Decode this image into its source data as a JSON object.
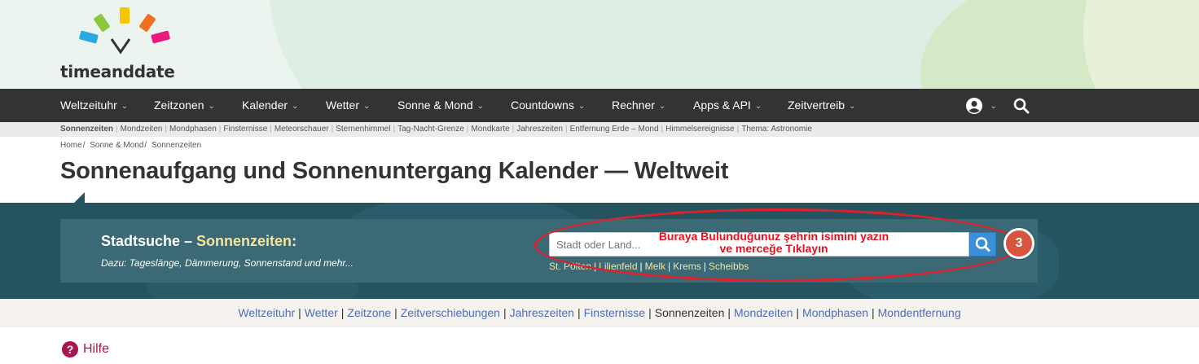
{
  "brand": {
    "logo_text": "timeanddate",
    "logo_colors": [
      "#8cc63f",
      "#f7c600",
      "#f26f22",
      "#ea1a7f",
      "#27aae1"
    ]
  },
  "nav": {
    "items": [
      {
        "label": "Weltzeituhr"
      },
      {
        "label": "Zeitzonen"
      },
      {
        "label": "Kalender"
      },
      {
        "label": "Wetter"
      },
      {
        "label": "Sonne & Mond"
      },
      {
        "label": "Countdowns"
      },
      {
        "label": "Rechner"
      },
      {
        "label": "Apps & API"
      },
      {
        "label": "Zeitvertreib"
      }
    ],
    "account_icon": "user-circle-icon",
    "search_icon": "search-icon"
  },
  "subnav": {
    "items": [
      "Sonnenzeiten",
      "Mondzeiten",
      "Mondphasen",
      "Finsternisse",
      "Meteorschauer",
      "Sternenhimmel",
      "Tag-Nacht-Grenze",
      "Mondkarte",
      "Jahreszeiten",
      "Entfernung Erde – Mond",
      "Himmelsereignisse",
      "Thema: Astronomie"
    ]
  },
  "breadcrumb": {
    "items": [
      "Home",
      "Sonne & Mond",
      "Sonnenzeiten"
    ]
  },
  "page_title": "Sonnenaufgang und Sonnenuntergang Kalender — Weltweit",
  "search": {
    "title_prefix": "Stadtsuche – ",
    "title_highlight": "Sonnenzeiten",
    "title_suffix": ":",
    "subtitle": "Dazu: Tageslänge, Dämmerung, Sonnenstand und mehr...",
    "placeholder": "Stadt oder Land...",
    "quick_links": [
      "St. Pölten",
      "Lilienfeld",
      "Melk",
      "Krems",
      "Scheibbs"
    ]
  },
  "annotation": {
    "line1": "Buraya Bulunduğunuz şehrin isimini yazın",
    "line2": "ve merceğe Tıklayın",
    "number": "3",
    "color": "#e0202a"
  },
  "bottom_links": {
    "items": [
      "Weltzeituhr",
      "Wetter",
      "Zeitzone",
      "Zeitverschiebungen",
      "Jahreszeiten",
      "Finsternisse",
      "Sonnenzeiten",
      "Mondzeiten",
      "Mondphasen",
      "Mondentfernung"
    ],
    "current": "Sonnenzeiten"
  },
  "help": {
    "icon": "?",
    "label": "Hilfe"
  }
}
